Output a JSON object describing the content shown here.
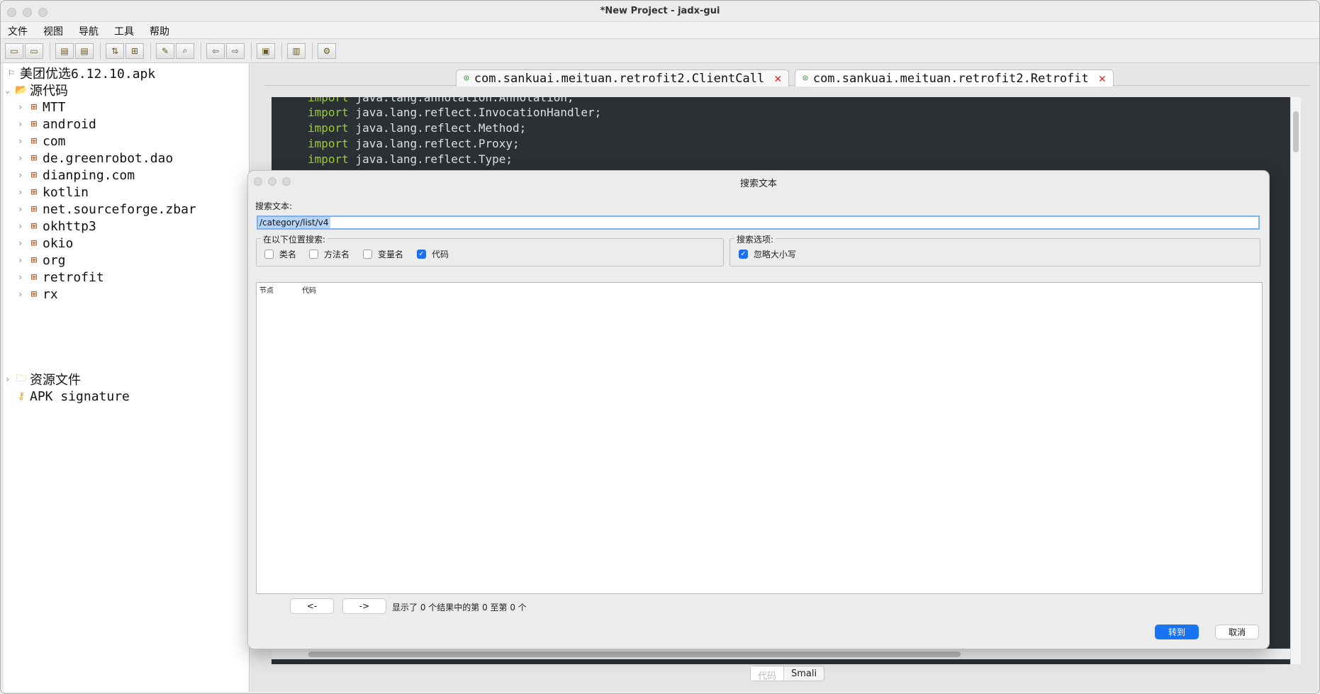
{
  "window": {
    "title": "*New Project - jadx-gui"
  },
  "menu": [
    "文件",
    "视图",
    "导航",
    "工具",
    "帮助"
  ],
  "toolbar": {
    "icons": [
      "open-file-icon",
      "add-files-icon",
      "save-all-icon",
      "export-icon",
      "sync-icon",
      "flatten-icon",
      "search-text-icon",
      "find-class-icon",
      "back-icon",
      "forward-icon",
      "decompile-icon",
      "log-viewer-icon",
      "preferences-icon"
    ]
  },
  "tree": {
    "root": "美团优选6.12.10.apk",
    "sources": "源代码",
    "packages": [
      "MTT",
      "android",
      "com",
      "de.greenrobot.dao",
      "dianping.com",
      "kotlin",
      "net.sourceforge.zbar",
      "okhttp3",
      "okio",
      "org",
      "retrofit",
      "rx"
    ],
    "resources": "资源文件",
    "signature": "APK signature"
  },
  "editor": {
    "tabs": [
      {
        "label": "com.sankuai.meituan.retrofit2.ClientCall"
      },
      {
        "label": "com.sankuai.meituan.retrofit2.Retrofit"
      }
    ],
    "code": [
      {
        "kw": "import",
        "rest": " java.lang.annotation.Annotation;"
      },
      {
        "kw": "import",
        "rest": " java.lang.reflect.InvocationHandler;"
      },
      {
        "kw": "import",
        "rest": " java.lang.reflect.Method;"
      },
      {
        "kw": "import",
        "rest": " java.lang.reflect.Proxy;"
      },
      {
        "kw": "import",
        "rest": " java.lang.reflect.Type;"
      }
    ],
    "bottom_tabs": {
      "code": "代码",
      "smali": "Smali"
    }
  },
  "dialog": {
    "title": "搜索文本",
    "search_label": "搜索文本:",
    "search_value": "/category/list/v4",
    "search_in": {
      "legend": "在以下位置搜索:",
      "options": [
        {
          "label": "类名",
          "checked": false
        },
        {
          "label": "方法名",
          "checked": false
        },
        {
          "label": "变量名",
          "checked": false
        },
        {
          "label": "代码",
          "checked": true
        }
      ]
    },
    "search_options": {
      "legend": "搜索选项:",
      "options": [
        {
          "label": "忽略大小写",
          "checked": true
        }
      ]
    },
    "results": {
      "col_node": "节点",
      "col_code": "代码"
    },
    "prev_label": "<-",
    "next_label": "->",
    "pager_text": "显示了 0 个结果中的第 0 至第 0 个",
    "goto_label": "转到",
    "cancel_label": "取消"
  },
  "colors": {
    "accent": "#1974f2",
    "code_bg": "#2b3034",
    "keyword": "#9acd32",
    "tab_close": "#dd2222",
    "class_icon": "#2e9a3c"
  }
}
